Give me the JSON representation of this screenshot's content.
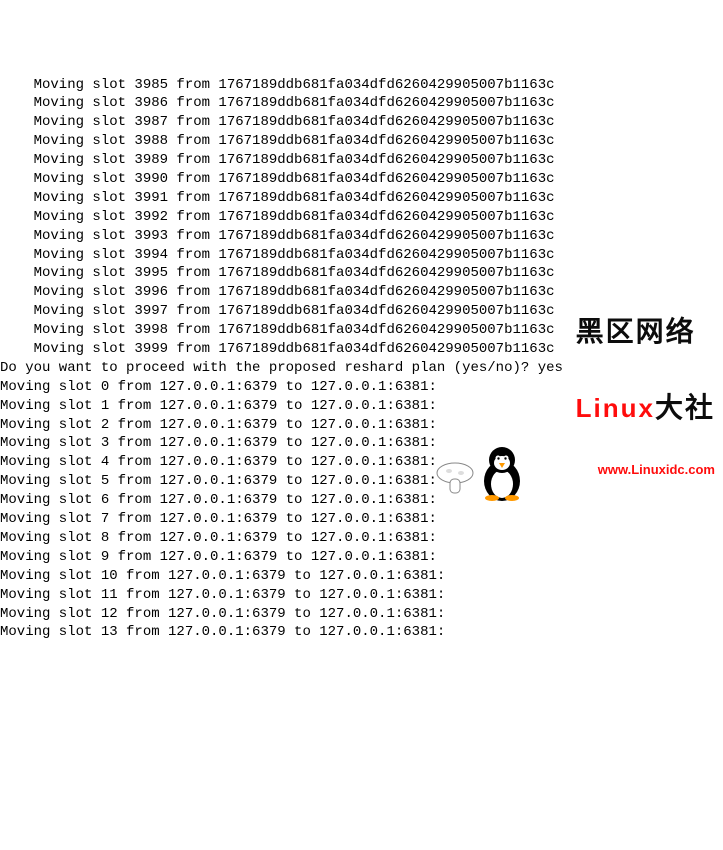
{
  "node_hash": "1767189ddb681fa034dfd6260429905007b1163c",
  "pre_slots": [
    {
      "slot": 3985
    },
    {
      "slot": 3986
    },
    {
      "slot": 3987
    },
    {
      "slot": 3988
    },
    {
      "slot": 3989
    },
    {
      "slot": 3990
    },
    {
      "slot": 3991
    },
    {
      "slot": 3992
    },
    {
      "slot": 3993
    },
    {
      "slot": 3994
    },
    {
      "slot": 3995
    },
    {
      "slot": 3996
    },
    {
      "slot": 3997
    },
    {
      "slot": 3998
    },
    {
      "slot": 3999
    }
  ],
  "prompt": "Do you want to proceed with the proposed reshard plan (yes/no)? yes",
  "moves": [
    {
      "slot": 0,
      "from": "127.0.0.1:6379",
      "to": "127.0.0.1:6381"
    },
    {
      "slot": 1,
      "from": "127.0.0.1:6379",
      "to": "127.0.0.1:6381"
    },
    {
      "slot": 2,
      "from": "127.0.0.1:6379",
      "to": "127.0.0.1:6381"
    },
    {
      "slot": 3,
      "from": "127.0.0.1:6379",
      "to": "127.0.0.1:6381"
    },
    {
      "slot": 4,
      "from": "127.0.0.1:6379",
      "to": "127.0.0.1:6381"
    },
    {
      "slot": 5,
      "from": "127.0.0.1:6379",
      "to": "127.0.0.1:6381"
    },
    {
      "slot": 6,
      "from": "127.0.0.1:6379",
      "to": "127.0.0.1:6381"
    },
    {
      "slot": 7,
      "from": "127.0.0.1:6379",
      "to": "127.0.0.1:6381"
    },
    {
      "slot": 8,
      "from": "127.0.0.1:6379",
      "to": "127.0.0.1:6381"
    },
    {
      "slot": 9,
      "from": "127.0.0.1:6379",
      "to": "127.0.0.1:6381"
    },
    {
      "slot": 10,
      "from": "127.0.0.1:6379",
      "to": "127.0.0.1:6381"
    },
    {
      "slot": 11,
      "from": "127.0.0.1:6379",
      "to": "127.0.0.1:6381"
    },
    {
      "slot": 12,
      "from": "127.0.0.1:6379",
      "to": "127.0.0.1:6381"
    },
    {
      "slot": 13,
      "from": "127.0.0.1:6379",
      "to": "127.0.0.1:6381"
    }
  ],
  "watermark": {
    "brand_cn": "黑区网络",
    "brand_en": "Linux",
    "suffix_cn": "大社",
    "url": "www.Linuxidc.com"
  }
}
